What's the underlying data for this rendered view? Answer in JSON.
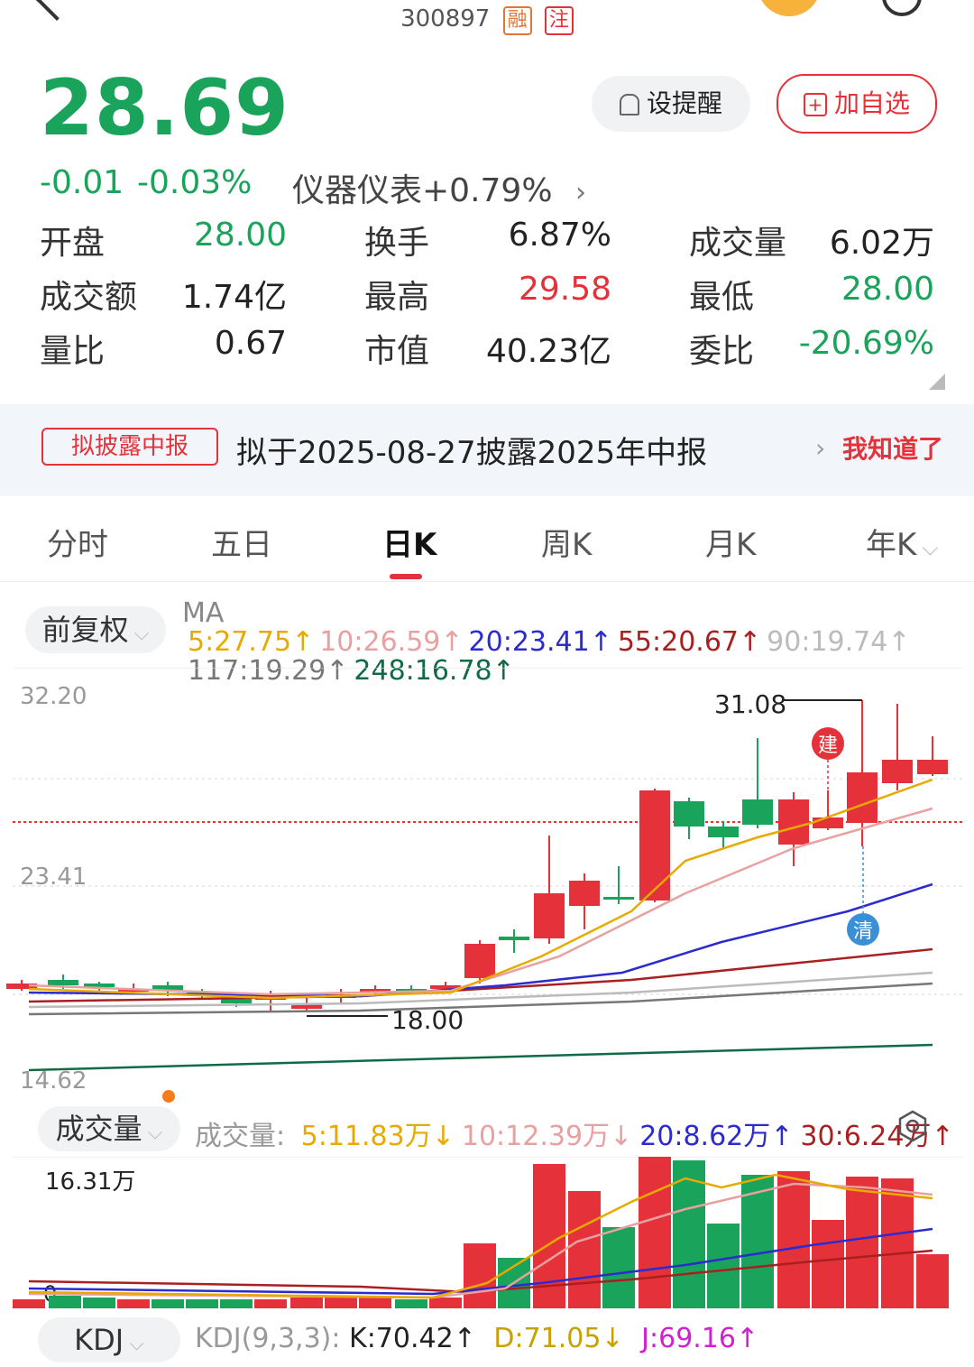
{
  "header": {
    "code": "300897",
    "tag_margin": "融",
    "tag_focus": "注"
  },
  "quote": {
    "price": "28.69",
    "change": "-0.01",
    "change_pct": "-0.03%",
    "sector": "仪器仪表+0.79%",
    "remind_label": "设提醒",
    "add_label": "加自选"
  },
  "stats": [
    [
      {
        "label": "开盘",
        "value": "28.00",
        "color": "green"
      },
      {
        "label": "换手",
        "value": "6.87%",
        "color": "dark"
      },
      {
        "label": "成交量",
        "value": "6.02万",
        "color": "dark"
      }
    ],
    [
      {
        "label": "成交额",
        "value": "1.74亿",
        "color": "dark"
      },
      {
        "label": "最高",
        "value": "29.58",
        "color": "red"
      },
      {
        "label": "最低",
        "value": "28.00",
        "color": "green"
      }
    ],
    [
      {
        "label": "量比",
        "value": "0.67",
        "color": "dark"
      },
      {
        "label": "市值",
        "value": "40.23亿",
        "color": "dark"
      },
      {
        "label": "委比",
        "value": "-20.69%",
        "color": "green"
      }
    ]
  ],
  "banner": {
    "tag": "拟披露中报",
    "text": "拟于2025-08-27披露2025年中报",
    "action": "我知道了"
  },
  "tabs": [
    "分时",
    "五日",
    "日K",
    "周K",
    "月K",
    "年K"
  ],
  "active_tab": "日K",
  "kchart": {
    "adjust": "前复权",
    "ma_prefix": "MA",
    "ma": [
      {
        "label": "5:27.75↑",
        "color": "#e8a900"
      },
      {
        "label": "10:26.59↑",
        "color": "#e8a0a0"
      },
      {
        "label": "20:23.41↑",
        "color": "#2b2bd0"
      },
      {
        "label": "55:20.67↑",
        "color": "#a82020"
      },
      {
        "label": "90:19.74↑",
        "color": "#bbbbbb"
      },
      {
        "label": "117:19.29↑",
        "color": "#777777"
      },
      {
        "label": "248:16.78↑",
        "color": "#0f6b45"
      }
    ],
    "axis_top": "32.20",
    "axis_mid": "23.41",
    "axis_bottom": "14.62",
    "high_label": "31.08",
    "low_label": "18.00",
    "marker_build": "建",
    "marker_clear": "清"
  },
  "volume": {
    "selector": "成交量",
    "prefix": "成交量:",
    "ma": [
      {
        "label": "5:11.83万↓",
        "color": "#e8a900"
      },
      {
        "label": "10:12.39万↓",
        "color": "#e8a0a0"
      },
      {
        "label": "20:8.62万↑",
        "color": "#2b2bd0"
      },
      {
        "label": "30:6.24万↑",
        "color": "#a82020"
      }
    ],
    "axis_top": "16.31万",
    "axis_zero": "0"
  },
  "kdj": {
    "selector": "KDJ",
    "params": "KDJ(9,3,3):",
    "k": "K:70.42↑",
    "d": "D:71.05↓",
    "j": "J:69.16↑"
  }
}
